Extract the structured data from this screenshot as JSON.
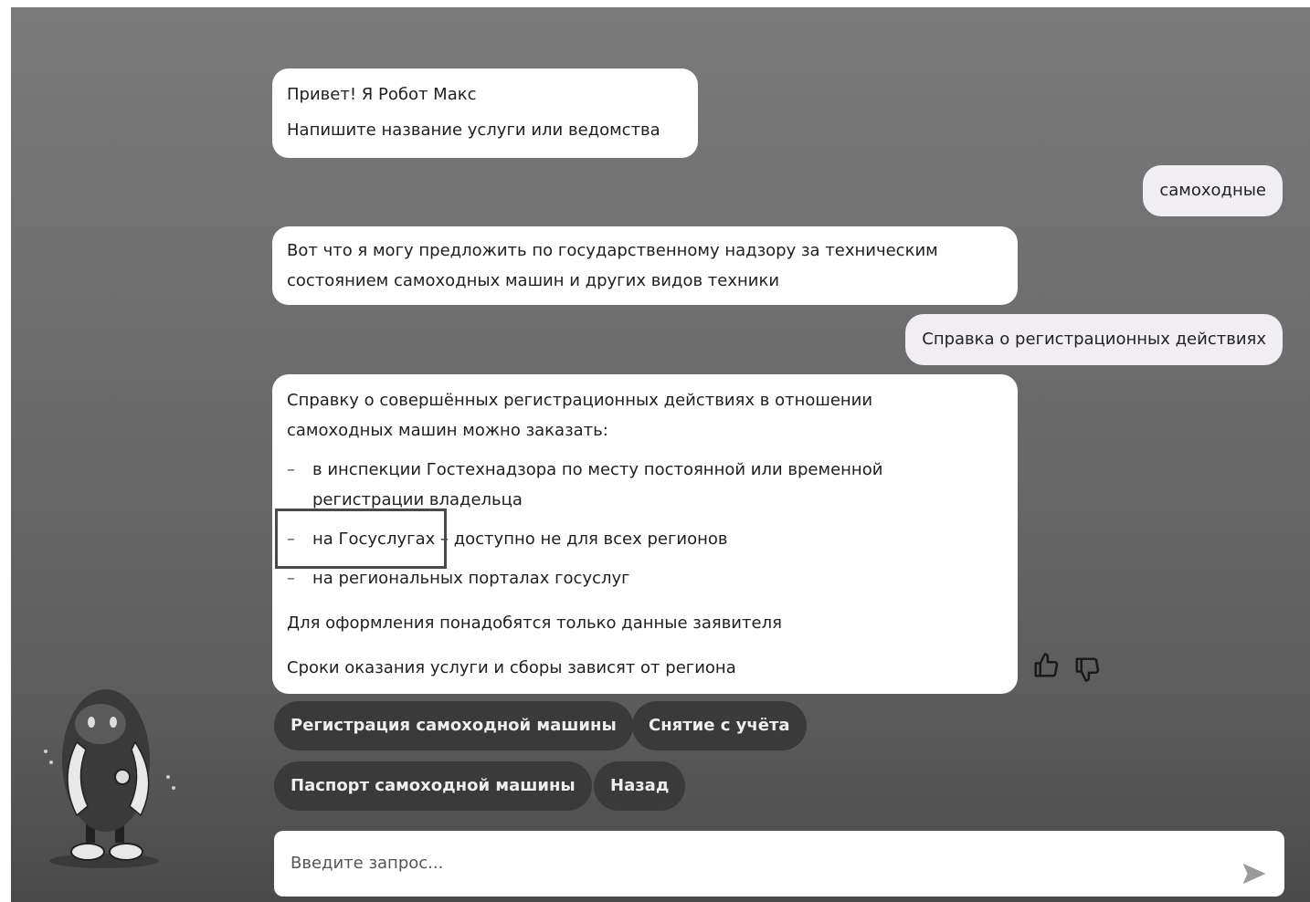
{
  "messages": {
    "bot1": {
      "line1": "Привет! Я Робот Макс",
      "line2": "Напишите название услуги или ведомства"
    },
    "user1": "самоходные",
    "bot2": {
      "line1": "Вот что я могу предложить по государственному надзору за техническим",
      "line2": "состоянием самоходных машин и других видов техники"
    },
    "user2": "Справка о регистрационных действиях",
    "bot3": {
      "intro_line1": "Справку о совершённых регистрационных действиях в отношении",
      "intro_line2": "самоходных машин можно заказать:",
      "items": [
        {
          "dash": "–",
          "line1": "в инспекции Гостехнадзора по месту постоянной или временной",
          "line2": "регистрации владельца"
        },
        {
          "dash": "–",
          "line1": "на Госуслугах – доступно не для всех регионов"
        },
        {
          "dash": "–",
          "line1": "на региональных порталах госуслуг"
        }
      ],
      "note1": "Для оформления понадобятся только данные заявителя",
      "note2": "Сроки оказания услуги и сборы зависят от региона"
    }
  },
  "feedback": {
    "like_icon": "thumbs-up-icon",
    "dislike_icon": "thumbs-down-icon"
  },
  "quick_replies": [
    "Регистрация самоходной машины",
    "Снятие с учёта",
    "Паспорт самоходной машины",
    "Назад"
  ],
  "input": {
    "placeholder": "Введите запрос...",
    "send_icon": "send-arrow-icon"
  },
  "avatar": {
    "icon": "robot-max-avatar"
  },
  "colors": {
    "background": "#6e6e6e",
    "bubble": "#ffffff",
    "user_bubble": "#f1eef3",
    "chip": "#3a3a3a"
  }
}
